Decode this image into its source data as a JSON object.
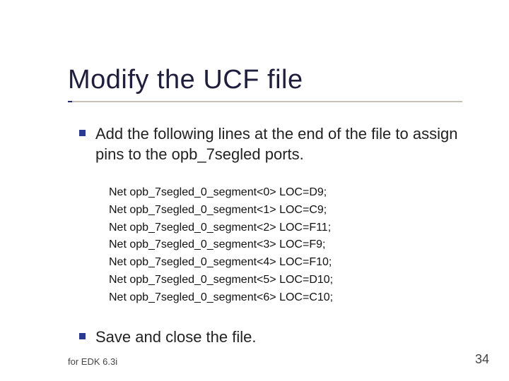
{
  "title": "Modify the UCF file",
  "bullets": [
    "Add the following lines at the end of the file to assign pins to the opb_7segled ports.",
    "Save and close the file."
  ],
  "code_lines": [
    "Net opb_7segled_0_segment<0> LOC=D9;",
    "Net opb_7segled_0_segment<1> LOC=C9;",
    "Net opb_7segled_0_segment<2> LOC=F11;",
    "Net opb_7segled_0_segment<3> LOC=F9;",
    "Net opb_7segled_0_segment<4> LOC=F10;",
    "Net opb_7segled_0_segment<5> LOC=D10;",
    "Net opb_7segled_0_segment<6> LOC=C10;"
  ],
  "footer": "for EDK 6.3i",
  "page_number": "34"
}
